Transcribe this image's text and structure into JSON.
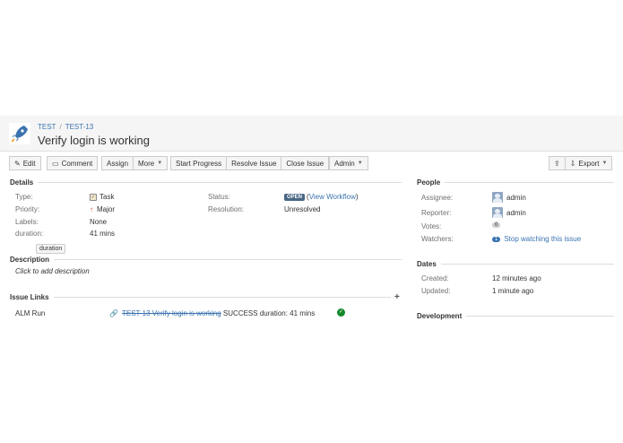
{
  "header": {
    "breadcrumb_project": "TEST",
    "breadcrumb_sep": "/",
    "breadcrumb_issue": "TEST-13",
    "summary": "Verify login is working",
    "project_avatar_icon": "rocket-icon"
  },
  "toolbar": {
    "edit": "Edit",
    "comment": "Comment",
    "assign": "Assign",
    "more": "More",
    "start_progress": "Start Progress",
    "resolve_issue": "Resolve Issue",
    "close_issue": "Close Issue",
    "admin": "Admin",
    "export": "Export"
  },
  "details": {
    "heading": "Details",
    "type_label": "Type:",
    "type_value": "Task",
    "priority_label": "Priority:",
    "priority_value": "Major",
    "labels_label": "Labels:",
    "labels_value": "None",
    "duration_label": "duration:",
    "duration_value": "41 mins",
    "status_label": "Status:",
    "status_lozenge": "OPEN",
    "view_workflow": "View Workflow",
    "resolution_label": "Resolution:",
    "resolution_value": "Unresolved",
    "chip": "duration"
  },
  "description": {
    "heading": "Description",
    "placeholder": "Click to add description"
  },
  "issue_links": {
    "heading": "Issue Links",
    "row_type": "ALM Run",
    "row_link": "TEST-13 Verify login is working",
    "row_text": "SUCCESS duration: 41 mins"
  },
  "people": {
    "heading": "People",
    "assignee_label": "Assignee:",
    "assignee_value": "admin",
    "reporter_label": "Reporter:",
    "reporter_value": "admin",
    "votes_label": "Votes:",
    "votes_value": "0",
    "watchers_label": "Watchers:",
    "watchers_count": "1",
    "watchers_link": "Stop watching this issue"
  },
  "dates": {
    "heading": "Dates",
    "created_label": "Created:",
    "created_value": "12 minutes ago",
    "updated_label": "Updated:",
    "updated_value": "1 minute ago"
  },
  "development": {
    "heading": "Development"
  },
  "colors": {
    "accent": "#3b73af",
    "status_open": "#4a6785",
    "success": "#14892c",
    "priority_major": "#d04437"
  }
}
